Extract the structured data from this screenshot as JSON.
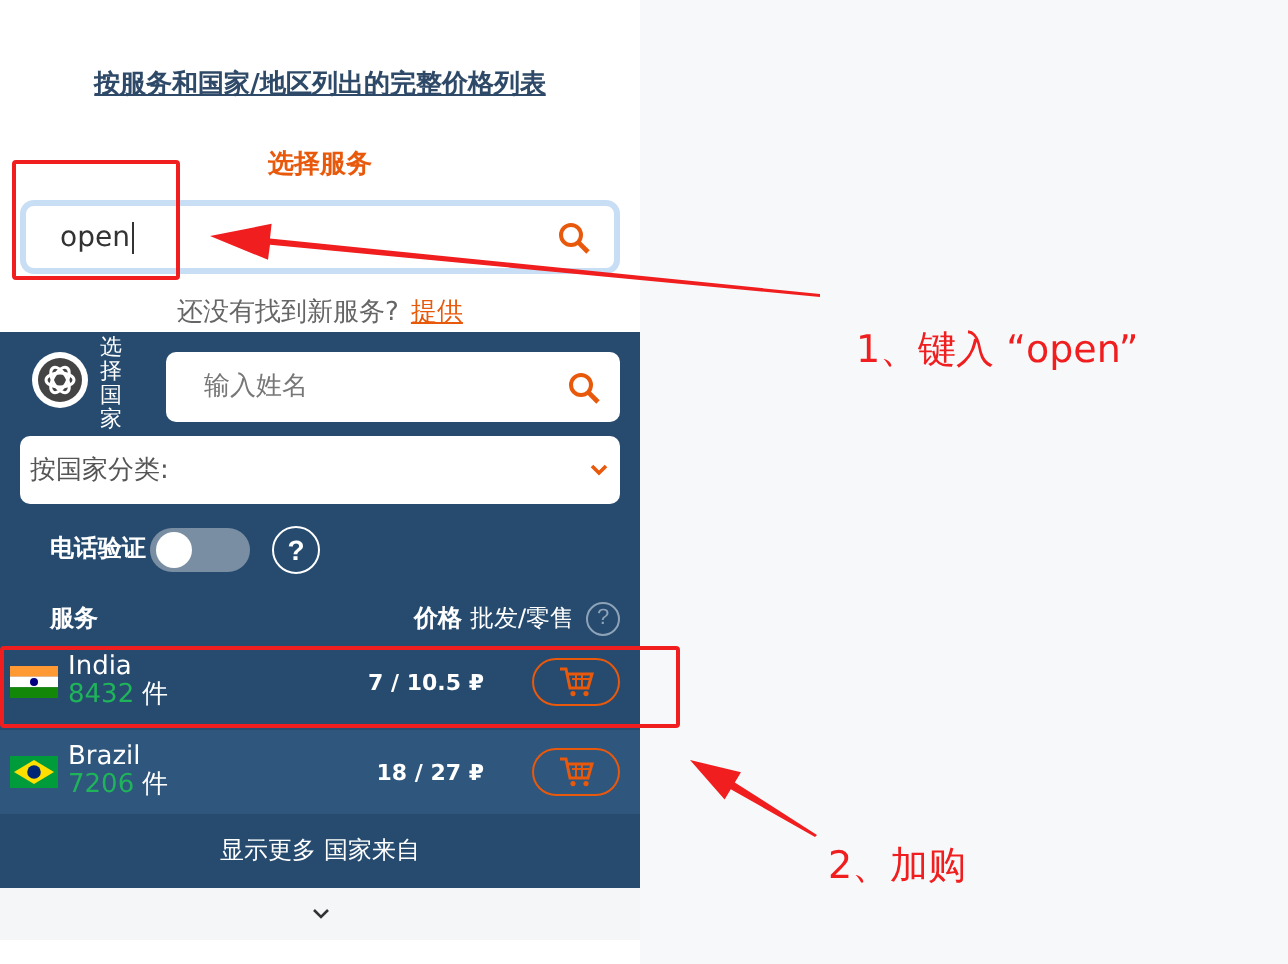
{
  "price_list_link": "按服务和国家/地区列出的完整价格列表",
  "service_heading": "选择服务",
  "service_search": {
    "value": "open"
  },
  "suggest": {
    "text": "还没有找到新服务?",
    "link": "提供"
  },
  "country_panel": {
    "vertical_label": "选择国家",
    "name_search": {
      "placeholder": "输入姓名"
    },
    "sort_select": {
      "value": "按国家分类:"
    },
    "phone_verify": {
      "label": "电话验证",
      "on": false,
      "help": "?"
    },
    "columns": {
      "service": "服务",
      "price": "价格",
      "price_type": "批发/零售",
      "help": "?"
    },
    "rows": [
      {
        "kind": "in",
        "country": "India",
        "count": "8432",
        "unit": "件",
        "price": "7 / 10.5 ₽"
      },
      {
        "kind": "br",
        "country": "Brazil",
        "count": "7206",
        "unit": "件",
        "price": "18 / 27 ₽"
      }
    ],
    "show_more": "显示更多 国家来自"
  },
  "annotations": [
    {
      "label": "1、键入 “open”"
    },
    {
      "label": "2、加购"
    }
  ]
}
